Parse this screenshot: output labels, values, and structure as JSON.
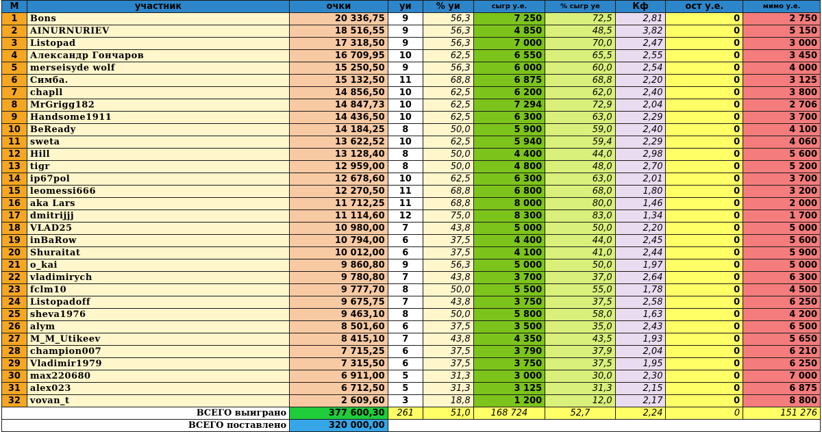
{
  "headers": [
    "М",
    "участник",
    "очки",
    "уи",
    "% уи",
    "сыгр у.е.",
    "% сыгр уе",
    "Кф",
    "ост у.е.",
    "мимо у.е."
  ],
  "rows": [
    {
      "rank": "1",
      "name": "Bons",
      "points": "20 336,75",
      "ui": "9",
      "pct_ui": "56,3",
      "won": "7 250",
      "pct_won": "72,5",
      "kf": "2,81",
      "rem": "0",
      "miss": "2 750"
    },
    {
      "rank": "2",
      "name": "AINURNURIEV",
      "points": "18 516,55",
      "ui": "9",
      "pct_ui": "56,3",
      "won": "4 850",
      "pct_won": "48,5",
      "kf": "3,82",
      "rem": "0",
      "miss": "5 150"
    },
    {
      "rank": "3",
      "name": "Listopad",
      "points": "17 318,50",
      "ui": "9",
      "pct_ui": "56,3",
      "won": "7 000",
      "pct_won": "70,0",
      "kf": "2,47",
      "rem": "0",
      "miss": "3 000"
    },
    {
      "rank": "4",
      "name": "Александр Гончаров",
      "points": "16 709,95",
      "ui": "10",
      "pct_ui": "62,5",
      "won": "6 550",
      "pct_won": "65,5",
      "kf": "2,55",
      "rem": "0",
      "miss": "3 450"
    },
    {
      "rank": "5",
      "name": "merseisyde wolf",
      "points": "15 250,50",
      "ui": "9",
      "pct_ui": "56,3",
      "won": "6 000",
      "pct_won": "60,0",
      "kf": "2,54",
      "rem": "0",
      "miss": "4 000"
    },
    {
      "rank": "6",
      "name": "Симба.",
      "points": "15 132,50",
      "ui": "11",
      "pct_ui": "68,8",
      "won": "6 875",
      "pct_won": "68,8",
      "kf": "2,20",
      "rem": "0",
      "miss": "3 125"
    },
    {
      "rank": "7",
      "name": "chapll",
      "points": "14 856,50",
      "ui": "10",
      "pct_ui": "62,5",
      "won": "6 200",
      "pct_won": "62,0",
      "kf": "2,40",
      "rem": "0",
      "miss": "3 800"
    },
    {
      "rank": "8",
      "name": "MrGrigg182",
      "points": "14 847,73",
      "ui": "10",
      "pct_ui": "62,5",
      "won": "7 294",
      "pct_won": "72,9",
      "kf": "2,04",
      "rem": "0",
      "miss": "2 706"
    },
    {
      "rank": "9",
      "name": "Handsome1911",
      "points": "14 436,50",
      "ui": "10",
      "pct_ui": "62,5",
      "won": "6 300",
      "pct_won": "63,0",
      "kf": "2,29",
      "rem": "0",
      "miss": "3 700"
    },
    {
      "rank": "10",
      "name": "BeReady",
      "points": "14 184,25",
      "ui": "8",
      "pct_ui": "50,0",
      "won": "5 900",
      "pct_won": "59,0",
      "kf": "2,40",
      "rem": "0",
      "miss": "4 100"
    },
    {
      "rank": "11",
      "name": "sweta",
      "points": "13 622,52",
      "ui": "10",
      "pct_ui": "62,5",
      "won": "5 940",
      "pct_won": "59,4",
      "kf": "2,29",
      "rem": "0",
      "miss": "4 060"
    },
    {
      "rank": "12",
      "name": "Hill",
      "points": "13 128,40",
      "ui": "8",
      "pct_ui": "50,0",
      "won": "4 400",
      "pct_won": "44,0",
      "kf": "2,98",
      "rem": "0",
      "miss": "5 600"
    },
    {
      "rank": "13",
      "name": "tigr",
      "points": "12 959,00",
      "ui": "8",
      "pct_ui": "50,0",
      "won": "4 800",
      "pct_won": "48,0",
      "kf": "2,70",
      "rem": "0",
      "miss": "5 200"
    },
    {
      "rank": "14",
      "name": "ip67pol",
      "points": "12 678,60",
      "ui": "10",
      "pct_ui": "62,5",
      "won": "6 300",
      "pct_won": "63,0",
      "kf": "2,01",
      "rem": "0",
      "miss": "3 700"
    },
    {
      "rank": "15",
      "name": "leomessi666",
      "points": "12 270,50",
      "ui": "11",
      "pct_ui": "68,8",
      "won": "6 800",
      "pct_won": "68,0",
      "kf": "1,80",
      "rem": "0",
      "miss": "3 200"
    },
    {
      "rank": "16",
      "name": "aka Lars",
      "points": "11 712,25",
      "ui": "11",
      "pct_ui": "68,8",
      "won": "8 000",
      "pct_won": "80,0",
      "kf": "1,46",
      "rem": "0",
      "miss": "2 000"
    },
    {
      "rank": "17",
      "name": "dmitrijjj",
      "points": "11 114,60",
      "ui": "12",
      "pct_ui": "75,0",
      "won": "8 300",
      "pct_won": "83,0",
      "kf": "1,34",
      "rem": "0",
      "miss": "1 700"
    },
    {
      "rank": "18",
      "name": "VLAD25",
      "points": "10 980,00",
      "ui": "7",
      "pct_ui": "43,8",
      "won": "5 000",
      "pct_won": "50,0",
      "kf": "2,20",
      "rem": "0",
      "miss": "5 000"
    },
    {
      "rank": "19",
      "name": "inBaRow",
      "points": "10 794,00",
      "ui": "6",
      "pct_ui": "37,5",
      "won": "4 400",
      "pct_won": "44,0",
      "kf": "2,45",
      "rem": "0",
      "miss": "5 600"
    },
    {
      "rank": "20",
      "name": "Shuraitat",
      "points": "10 012,00",
      "ui": "6",
      "pct_ui": "37,5",
      "won": "4 100",
      "pct_won": "41,0",
      "kf": "2,44",
      "rem": "0",
      "miss": "5 900"
    },
    {
      "rank": "21",
      "name": "o_kai",
      "points": "9 860,80",
      "ui": "9",
      "pct_ui": "56,3",
      "won": "5 000",
      "pct_won": "50,0",
      "kf": "1,97",
      "rem": "0",
      "miss": "5 000"
    },
    {
      "rank": "22",
      "name": "vladimirych",
      "points": "9 780,80",
      "ui": "7",
      "pct_ui": "43,8",
      "won": "3 700",
      "pct_won": "37,0",
      "kf": "2,64",
      "rem": "0",
      "miss": "6 300"
    },
    {
      "rank": "23",
      "name": "fclm10",
      "points": "9 777,70",
      "ui": "8",
      "pct_ui": "50,0",
      "won": "5 500",
      "pct_won": "55,0",
      "kf": "1,78",
      "rem": "0",
      "miss": "4 500"
    },
    {
      "rank": "24",
      "name": "Listopadoff",
      "points": "9 675,75",
      "ui": "7",
      "pct_ui": "43,8",
      "won": "3 750",
      "pct_won": "37,5",
      "kf": "2,58",
      "rem": "0",
      "miss": "6 250"
    },
    {
      "rank": "25",
      "name": "sheva1976",
      "points": "9 463,10",
      "ui": "8",
      "pct_ui": "50,0",
      "won": "5 800",
      "pct_won": "58,0",
      "kf": "1,63",
      "rem": "0",
      "miss": "4 200"
    },
    {
      "rank": "26",
      "name": "alym",
      "points": "8 501,60",
      "ui": "6",
      "pct_ui": "37,5",
      "won": "3 500",
      "pct_won": "35,0",
      "kf": "2,43",
      "rem": "0",
      "miss": "6 500"
    },
    {
      "rank": "27",
      "name": "M_M_Utikeev",
      "points": "8 415,10",
      "ui": "7",
      "pct_ui": "43,8",
      "won": "4 350",
      "pct_won": "43,5",
      "kf": "1,93",
      "rem": "0",
      "miss": "5 650"
    },
    {
      "rank": "28",
      "name": "champion007",
      "points": "7 715,25",
      "ui": "6",
      "pct_ui": "37,5",
      "won": "3 790",
      "pct_won": "37,9",
      "kf": "2,04",
      "rem": "0",
      "miss": "6 210"
    },
    {
      "rank": "29",
      "name": "Vladimir1979",
      "points": "7 315,50",
      "ui": "6",
      "pct_ui": "37,5",
      "won": "3 750",
      "pct_won": "37,5",
      "kf": "1,95",
      "rem": "0",
      "miss": "6 250"
    },
    {
      "rank": "30",
      "name": "max220680",
      "points": "6 911,00",
      "ui": "5",
      "pct_ui": "31,3",
      "won": "3 000",
      "pct_won": "30,0",
      "kf": "2,30",
      "rem": "0",
      "miss": "7 000"
    },
    {
      "rank": "31",
      "name": "alex023",
      "points": "6 712,50",
      "ui": "5",
      "pct_ui": "31,3",
      "won": "3 125",
      "pct_won": "31,3",
      "kf": "2,15",
      "rem": "0",
      "miss": "6 875"
    },
    {
      "rank": "32",
      "name": "vovan_t",
      "points": "2 609,60",
      "ui": "3",
      "pct_ui": "18,8",
      "won": "1 200",
      "pct_won": "12,0",
      "kf": "2,17",
      "rem": "0",
      "miss": "8 800"
    }
  ],
  "footer": {
    "total_won_label": "ВСЕГО выиграно",
    "total_won": "377 600,30",
    "ui": "261",
    "pct_ui": "51,0",
    "won": "168 724",
    "pct_won": "52,7",
    "kf": "2,24",
    "rem": "0",
    "miss": "151 276",
    "total_staked_label": "ВСЕГО поставлено",
    "total_staked": "320 000,00"
  }
}
